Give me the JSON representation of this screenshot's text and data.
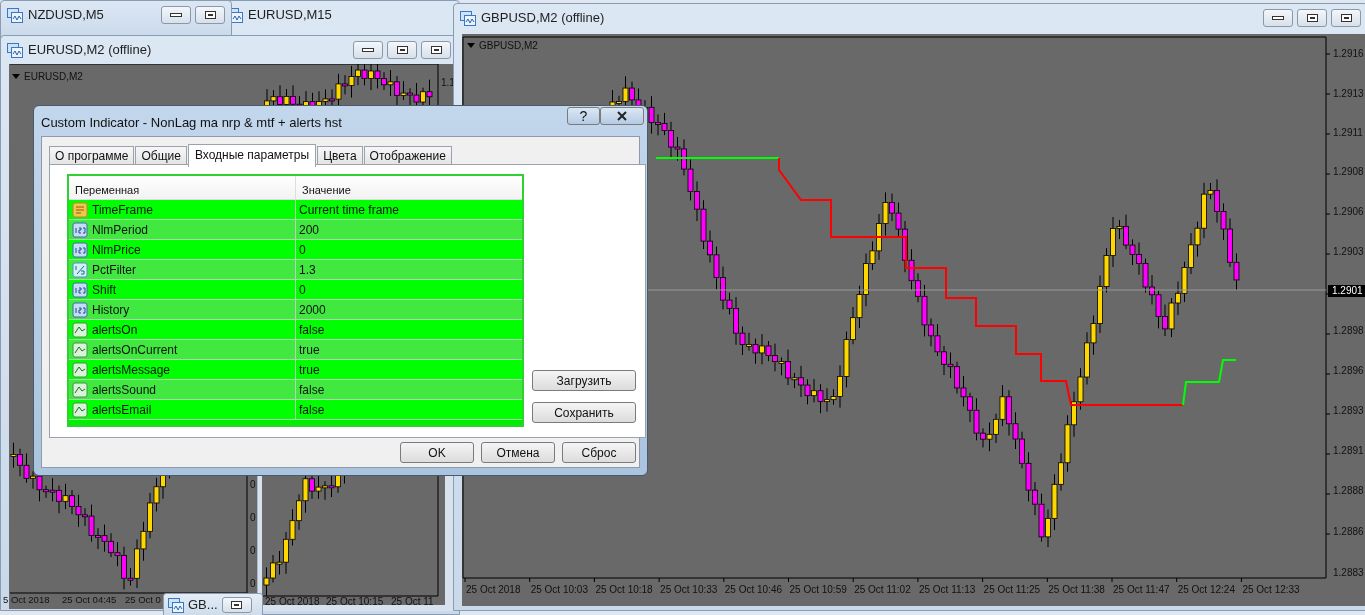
{
  "nzd_window": {
    "title": "NZDUSD,M5"
  },
  "eur_m15_window": {
    "title": "EURUSD,M15",
    "time_labels": [
      "25 Oct 2018",
      "25 Oct 10:15",
      "25 Oct 11"
    ]
  },
  "eur_m2_window": {
    "title": "EURUSD,M2 (offline)",
    "chart_label": "EURUSD,M2",
    "price_labels": [
      "1.1"
    ],
    "lower_price_labels": [
      "0",
      "0",
      "0",
      "0"
    ],
    "time_labels": [
      "5 Oct 2018",
      "25 Oct 04:45",
      "25 Oct 0"
    ]
  },
  "gbp_window": {
    "title": "GBPUSD,M2 (offline)",
    "chart_label": "GBPUSD,M2",
    "price_labels": [
      "1.2916",
      "1.2913",
      "1.2911",
      "1.2908",
      "1.2906",
      "1.2903",
      "1.2898",
      "1.2896",
      "1.2893",
      "1.2891",
      "1.2888",
      "1.2886",
      "1.2883"
    ],
    "current_price": "1.2901",
    "time_labels": [
      "25 Oct 2018",
      "25 Oct 10:03",
      "25 Oct 10:18",
      "25 Oct 10:33",
      "25 Oct 10:46",
      "25 Oct 10:59",
      "25 Oct 11:02",
      "25 Oct 11:13",
      "25 Oct 11:25",
      "25 Oct 11:38",
      "25 Oct 11:47",
      "25 Oct 12:24",
      "25 Oct 12:33"
    ]
  },
  "minimized_window": {
    "title": "GB..."
  },
  "dialog": {
    "title": "Custom Indicator - NonLag ma nrp & mtf + alerts hst",
    "help": "?",
    "tabs": [
      {
        "label": "О программе",
        "selected": false
      },
      {
        "label": "Общие",
        "selected": false
      },
      {
        "label": "Входные параметры",
        "selected": true
      },
      {
        "label": "Цвета",
        "selected": false
      },
      {
        "label": "Отображение",
        "selected": false
      }
    ],
    "columns": [
      "Переменная",
      "Значение"
    ],
    "rows": [
      {
        "kind": "string",
        "name": "TimeFrame",
        "value": "Current time frame"
      },
      {
        "kind": "int",
        "name": "NlmPeriod",
        "value": "200"
      },
      {
        "kind": "int",
        "name": "NlmPrice",
        "value": "0"
      },
      {
        "kind": "double",
        "name": "PctFilter",
        "value": "1.3"
      },
      {
        "kind": "int",
        "name": "Shift",
        "value": "0"
      },
      {
        "kind": "int",
        "name": "History",
        "value": "2000"
      },
      {
        "kind": "bool",
        "name": "alertsOn",
        "value": "false"
      },
      {
        "kind": "bool",
        "name": "alertsOnCurrent",
        "value": "true"
      },
      {
        "kind": "bool",
        "name": "alertsMessage",
        "value": "true"
      },
      {
        "kind": "bool",
        "name": "alertsSound",
        "value": "false"
      },
      {
        "kind": "bool",
        "name": "alertsEmail",
        "value": "false"
      }
    ],
    "side_buttons": [
      "Загрузить",
      "Сохранить"
    ],
    "buttons": [
      "OK",
      "Отмена",
      "Сброс"
    ]
  }
}
